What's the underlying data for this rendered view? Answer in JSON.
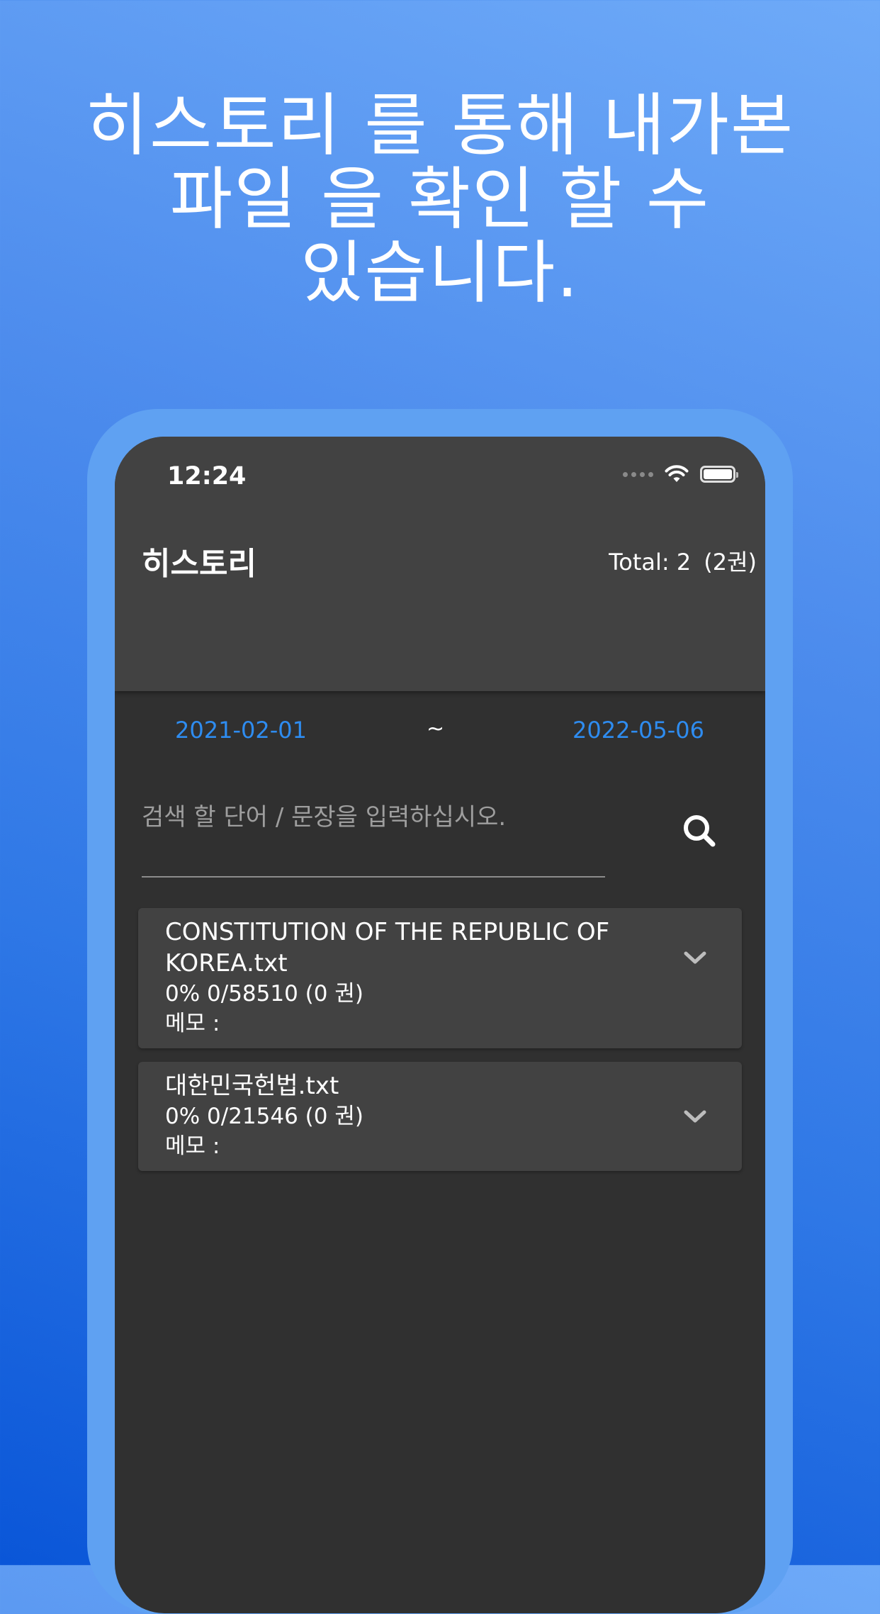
{
  "promo": {
    "line1": "히스토리 를 통해 내가본",
    "line2": "파일 을 확인 할 수",
    "line3": "있습니다."
  },
  "status_bar": {
    "time": "12:24"
  },
  "app_bar": {
    "title": "히스토리",
    "total": "Total: 2",
    "volumes": "(2권)"
  },
  "date_range": {
    "start": "2021-02-01",
    "separator": "~",
    "end": "2022-05-06"
  },
  "search": {
    "placeholder": "검색 할 단어 / 문장을 입력하십시오.",
    "value": "",
    "icon": "search-icon"
  },
  "files": [
    {
      "name": "CONSTITUTION OF THE REPUBLIC OF KOREA.txt",
      "progress": "0% 0/58510 (0 권)",
      "memo": "메모 :",
      "icon": "chevron-down-icon"
    },
    {
      "name": "대한민국헌법.txt",
      "progress": "0% 0/21546 (0 권)",
      "memo": "메모 :",
      "icon": "chevron-down-icon"
    }
  ],
  "colors": {
    "accent_date": "#2e8cf0",
    "app_bar": "#424242",
    "background": "#303030",
    "phone_frame": "#5fa1f2"
  }
}
